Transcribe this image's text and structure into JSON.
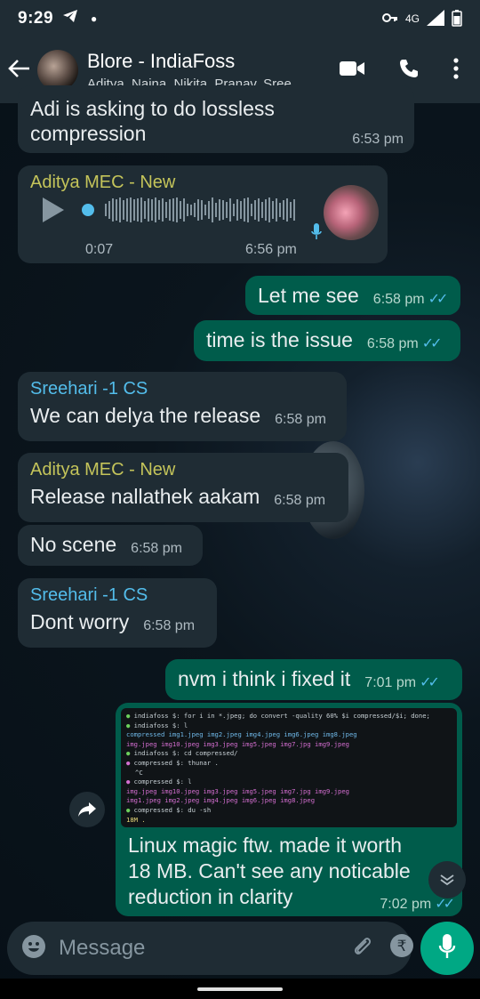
{
  "status": {
    "time": "9:29",
    "network": "4G"
  },
  "header": {
    "title": "Blore - IndiaFoss",
    "subtitle": "Aditya, Naina, Nikita, Pranav, Sree..."
  },
  "messages": {
    "m1": {
      "text": "Adi is asking to do lossless compression",
      "time": "6:53 pm"
    },
    "m2": {
      "sender": "Aditya MEC - New",
      "duration": "0:07",
      "time": "6:56 pm"
    },
    "m3": {
      "text": "Let me see",
      "time": "6:58 pm"
    },
    "m4": {
      "text": "time is the issue",
      "time": "6:58 pm"
    },
    "m5": {
      "sender": "Sreehari -1 CS",
      "text": "We can delya the release",
      "time": "6:58 pm"
    },
    "m6": {
      "sender": "Aditya MEC - New",
      "text": "Release nallathek aakam",
      "time": "6:58 pm"
    },
    "m7": {
      "text": "No scene",
      "time": "6:58 pm"
    },
    "m8": {
      "sender": "Sreehari -1 CS",
      "text": "Dont worry",
      "time": "6:58 pm"
    },
    "m9": {
      "text": "nvm i think i fixed it",
      "time": "7:01 pm"
    },
    "m10": {
      "text": "Linux magic ftw. made it worth 18 MB. Can't see any noticable reduction in clarity",
      "time": "7:02 pm"
    }
  },
  "terminal": {
    "l1": "indiafoss $: for i in *.jpeg; do convert -quality 60% $i compressed/$i; done;",
    "l2": "indiafoss $: l",
    "l3": "compressed  img1.jpeg   img2.jpeg   img4.jpeg   img6.jpeg   img8.jpeg",
    "l4": "img.jpeg    img10.jpeg  img3.jpeg   img5.jpeg   img7.jpg    img9.jpeg",
    "l5": "indiafoss $: cd compressed/",
    "l6": "compressed $: thunar .",
    "l7": "^C",
    "l8": "compressed $: l",
    "l9": "img.jpeg    img10.jpeg  img3.jpeg   img5.jpeg   img7.jpg    img9.jpeg",
    "l10": "img1.jpeg   img2.jpeg   img4.jpeg   img6.jpeg   img8.jpeg",
    "l11": "compressed $: du -sh",
    "l12": "18M     ."
  },
  "input": {
    "placeholder": "Message"
  },
  "colors": {
    "incoming": "#1f2c34",
    "outgoing": "#005c4b",
    "sender_yellow": "#c4c45a",
    "sender_blue": "#53bdeb",
    "accent": "#00a884"
  }
}
